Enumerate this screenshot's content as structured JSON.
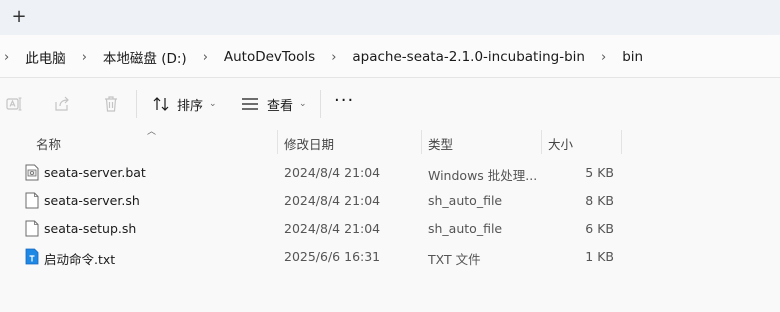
{
  "tabs": {
    "new_tab_label": "+"
  },
  "breadcrumb": [
    "此电脑",
    "本地磁盘 (D:)",
    "AutoDevTools",
    "apache-seata-2.1.0-incubating-bin",
    "bin"
  ],
  "toolbar": {
    "sort_label": "排序",
    "view_label": "查看",
    "more_label": "···"
  },
  "columns": {
    "name": "名称",
    "modified": "修改日期",
    "type": "类型",
    "size": "大小"
  },
  "files": [
    {
      "name": "seata-server.bat",
      "modified": "2024/8/4 21:04",
      "type": "Windows 批处理...",
      "size": "5 KB",
      "icon": "batch-file-icon"
    },
    {
      "name": "seata-server.sh",
      "modified": "2024/8/4 21:04",
      "type": "sh_auto_file",
      "size": "8 KB",
      "icon": "generic-file-icon"
    },
    {
      "name": "seata-setup.sh",
      "modified": "2024/8/4 21:04",
      "type": "sh_auto_file",
      "size": "6 KB",
      "icon": "generic-file-icon"
    },
    {
      "name": "启动命令.txt",
      "modified": "2025/6/6 16:31",
      "type": "TXT 文件",
      "size": "1 KB",
      "icon": "text-file-icon"
    }
  ],
  "colors": {
    "accent": "#1a73e8",
    "text_file_icon": "#1e88e5"
  }
}
